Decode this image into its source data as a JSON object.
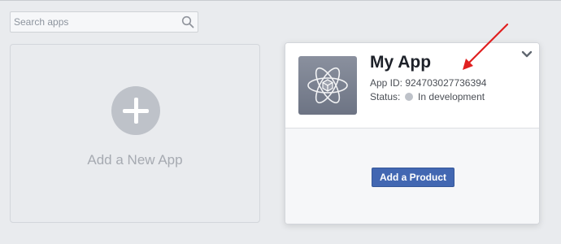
{
  "search": {
    "placeholder": "Search apps",
    "icon": "search-icon"
  },
  "add_app": {
    "label": "Add a New App",
    "icon": "plus-circle-icon"
  },
  "app": {
    "name": "My App",
    "id_label": "App ID:",
    "id_value": "924703027736394",
    "status_label": "Status:",
    "status_value": "In development",
    "status_color": "#bec2c9",
    "icon": "atom-icon",
    "menu_icon": "chevron-down-icon"
  },
  "product_button": {
    "label": "Add a Product",
    "color": "#4267b2"
  },
  "annotation": {
    "icon": "red-arrow-icon",
    "color": "#e02020"
  }
}
